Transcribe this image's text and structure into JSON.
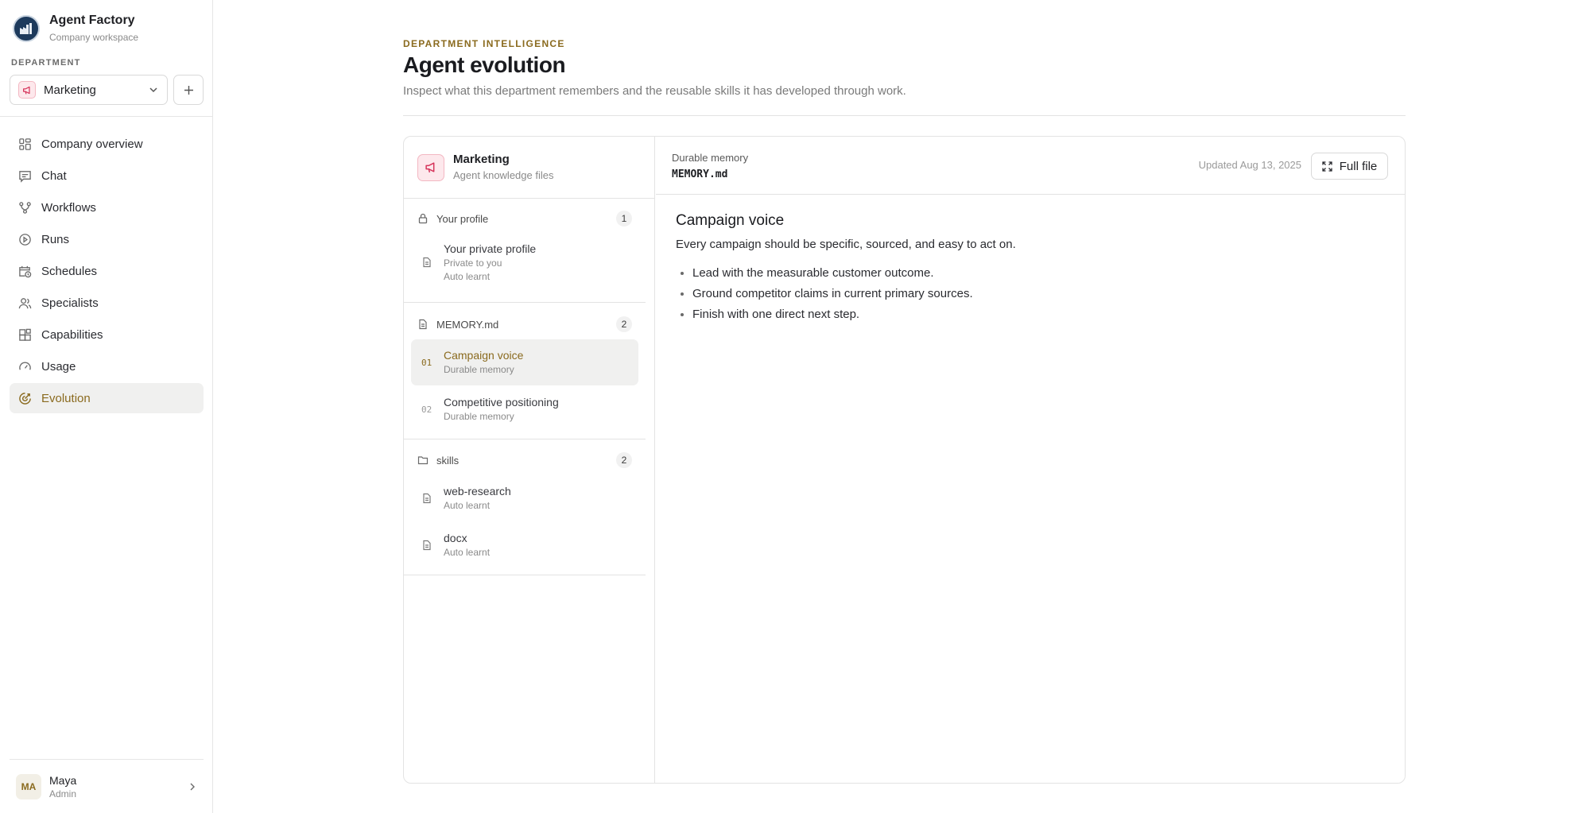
{
  "brand": {
    "name": "Agent Factory",
    "subtitle": "Company workspace"
  },
  "department": {
    "label": "DEPARTMENT",
    "selected": "Marketing"
  },
  "nav": [
    {
      "label": "Company overview",
      "icon": "grid-icon"
    },
    {
      "label": "Chat",
      "icon": "chat-icon"
    },
    {
      "label": "Workflows",
      "icon": "workflow-icon"
    },
    {
      "label": "Runs",
      "icon": "play-circle-icon"
    },
    {
      "label": "Schedules",
      "icon": "calendar-clock-icon"
    },
    {
      "label": "Specialists",
      "icon": "users-icon"
    },
    {
      "label": "Capabilities",
      "icon": "blocks-icon"
    },
    {
      "label": "Usage",
      "icon": "gauge-icon"
    },
    {
      "label": "Evolution",
      "icon": "evolution-icon",
      "active": true
    }
  ],
  "user": {
    "initials": "MA",
    "name": "Maya",
    "role": "Admin"
  },
  "header": {
    "eyebrow": "DEPARTMENT INTELLIGENCE",
    "title": "Agent evolution",
    "description": "Inspect what this department remembers and the reusable skills it has developed through work."
  },
  "files_panel": {
    "title": "Marketing",
    "subtitle": "Agent knowledge files",
    "groups": [
      {
        "title": "Your profile",
        "count": "1",
        "items": [
          {
            "title": "Your private profile",
            "sub1": "Private to you",
            "sub2": "Auto learnt"
          }
        ]
      },
      {
        "title": "MEMORY.md",
        "count": "2",
        "items": [
          {
            "index": "01",
            "title": "Campaign voice",
            "sub": "Durable memory",
            "active": true
          },
          {
            "index": "02",
            "title": "Competitive positioning",
            "sub": "Durable memory"
          }
        ]
      },
      {
        "title": "skills",
        "count": "2",
        "items": [
          {
            "title": "web-research",
            "sub": "Auto learnt"
          },
          {
            "title": "docx",
            "sub": "Auto learnt"
          }
        ]
      }
    ]
  },
  "viewer": {
    "kind": "Durable memory",
    "file": "MEMORY.md",
    "updated": "Updated Aug 13, 2025",
    "full_file_label": "Full file",
    "heading": "Campaign voice",
    "paragraph": "Every campaign should be specific, sourced, and easy to act on.",
    "bullets": [
      "Lead with the measurable customer outcome.",
      "Ground competitor claims in current primary sources.",
      "Finish with one direct next step."
    ]
  },
  "colors": {
    "accent": "#8a6a1e",
    "brand_chip": "#fde8ec",
    "active_bg": "#f0f0ef"
  }
}
